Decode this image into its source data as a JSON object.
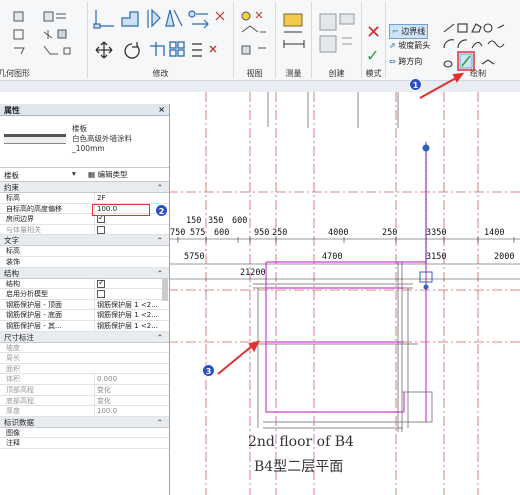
{
  "ribbon": {
    "groups": {
      "geometry": "几何图形",
      "modify": "修改",
      "view": "视图",
      "measure": "测量",
      "create": "创建",
      "mode": "模式",
      "draw": "绘制"
    },
    "mode_buttons": {
      "boundary_line": "边界线",
      "slope_arrow": "坡度箭头",
      "span_direction": "跨方向"
    }
  },
  "properties": {
    "title": "属性",
    "close": "×",
    "type_family": "楼板",
    "type_name_line1": "白色高级外墙涂料",
    "type_name_line2": "_100mm",
    "selector_value": "楼板",
    "edit_type_label": "编辑类型",
    "sections": [
      {
        "title": "约束",
        "rows": [
          {
            "k": "标高",
            "v": "2F",
            "kind": "text"
          },
          {
            "k": "自标高的高度偏移",
            "v": "100.0",
            "kind": "text"
          },
          {
            "k": "房间边界",
            "v": "",
            "kind": "check-on"
          },
          {
            "k": "与体量相关",
            "v": "",
            "kind": "check-off",
            "dim": true
          }
        ]
      },
      {
        "title": "文字",
        "rows": [
          {
            "k": "标高",
            "v": "",
            "kind": "text"
          },
          {
            "k": "装饰",
            "v": "",
            "kind": "text"
          }
        ]
      },
      {
        "title": "结构",
        "rows": [
          {
            "k": "结构",
            "v": "",
            "kind": "check-on"
          },
          {
            "k": "启用分析模型",
            "v": "",
            "kind": "check-off"
          },
          {
            "k": "钢筋保护层 - 顶面",
            "v": "钢筋保护层 1 <2...",
            "kind": "text"
          },
          {
            "k": "钢筋保护层 - 底面",
            "v": "钢筋保护层 1 <2...",
            "kind": "text"
          },
          {
            "k": "钢筋保护层 - 其...",
            "v": "钢筋保护层 1 <2...",
            "kind": "text"
          }
        ]
      },
      {
        "title": "尺寸标注",
        "rows": [
          {
            "k": "坡度",
            "v": "",
            "kind": "text",
            "dim": true
          },
          {
            "k": "周长",
            "v": "",
            "kind": "text",
            "dim": true
          },
          {
            "k": "面积",
            "v": "",
            "kind": "text",
            "dim": true
          },
          {
            "k": "体积",
            "v": "0.000",
            "kind": "text",
            "dim": true
          },
          {
            "k": "顶部高程",
            "v": "变化",
            "kind": "text",
            "dim": true
          },
          {
            "k": "底部高程",
            "v": "变化",
            "kind": "text",
            "dim": true
          },
          {
            "k": "厚度",
            "v": "100.0",
            "kind": "text",
            "dim": true
          }
        ]
      },
      {
        "title": "标识数据",
        "rows": [
          {
            "k": "图像",
            "v": "",
            "kind": "text"
          },
          {
            "k": "注释",
            "v": "",
            "kind": "text"
          }
        ]
      }
    ]
  },
  "drawing": {
    "dims_row1": [
      "150",
      "350",
      "600"
    ],
    "dims_row2": [
      "750",
      "575",
      "600",
      "950",
      "250",
      "4000",
      "250",
      "3350",
      "1400"
    ],
    "dims_row3": [
      "5750",
      "4700",
      "3150",
      "2000"
    ],
    "dim_total": "21200",
    "title_en": "2nd floor of B4",
    "title_cn": "B4型二层平面"
  },
  "annotations": [
    "1",
    "2",
    "3"
  ],
  "colors": {
    "accent_red": "#e03030",
    "badge_blue": "#2a4fc8",
    "sketch_magenta": "#d040d0",
    "axis_red": "#d06060"
  }
}
